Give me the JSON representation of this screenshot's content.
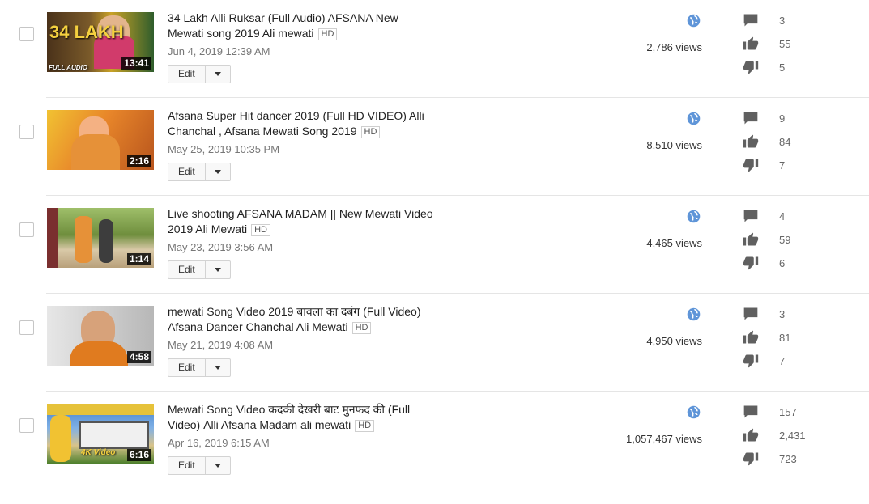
{
  "videos": [
    {
      "title": "34 Lakh Alli Ruksar (Full Audio) AFSANA New Mewati song 2019 Ali mewati",
      "hd": "HD",
      "date": "Jun 4, 2019 12:39 AM",
      "duration": "13:41",
      "thumb_overlay": "34 LAKH",
      "thumb_caption": "FULL AUDIO",
      "views": "2,786 views",
      "comments": "3",
      "likes": "55",
      "dislikes": "5",
      "edit_label": "Edit",
      "thumb_colors": [
        "#5a3b1e",
        "#c9a227",
        "#2f5d2c"
      ]
    },
    {
      "title": "Afsana Super Hit dancer 2019 (Full HD VIDEO) Alli Chanchal , Afsana Mewati Song 2019",
      "hd": "HD",
      "date": "May 25, 2019 10:35 PM",
      "duration": "2:16",
      "views": "8,510 views",
      "comments": "9",
      "likes": "84",
      "dislikes": "7",
      "edit_label": "Edit",
      "thumb_colors": [
        "#e8862a",
        "#f1c232",
        "#b8551d"
      ]
    },
    {
      "title": "Live shooting AFSANA MADAM || New Mewati Video 2019 Ali Mewati",
      "hd": "HD",
      "date": "May 23, 2019 3:56 AM",
      "duration": "1:14",
      "views": "4,465 views",
      "comments": "4",
      "likes": "59",
      "dislikes": "6",
      "edit_label": "Edit",
      "thumb_colors": [
        "#6f8e3d",
        "#d9b48a",
        "#7a2f2f"
      ]
    },
    {
      "title": "mewati Song Video 2019 बावला का दबंग (Full Video) Afsana Dancer Chanchal Ali Mewati",
      "hd": "HD",
      "date": "May 21, 2019 4:08 AM",
      "duration": "4:58",
      "views": "4,950 views",
      "comments": "3",
      "likes": "81",
      "dislikes": "7",
      "edit_label": "Edit",
      "thumb_colors": [
        "#cfcfcf",
        "#e07b1f",
        "#8b5a3c"
      ]
    },
    {
      "title": "Mewati Song Video कदकी देखरी बाट मुनफद की (Full Video) Alli Afsana Madam ali mewati",
      "hd": "HD",
      "date": "Apr 16, 2019 6:15 AM",
      "duration": "6:16",
      "thumb_overlay": "4K Video",
      "views": "1,057,467 views",
      "comments": "157",
      "likes": "2,431",
      "dislikes": "723",
      "edit_label": "Edit",
      "thumb_colors": [
        "#3f7ec9",
        "#e6c23a",
        "#4d7f2c"
      ]
    }
  ],
  "icons": {
    "visibility": "globe-icon",
    "comments": "comment-icon",
    "likes": "thumbs-up-icon",
    "dislikes": "thumbs-down-icon",
    "edit_menu": "chevron-down-icon"
  },
  "colors": {
    "globe": "#5f95d8",
    "stat_icon": "#606060",
    "divider": "#e5e5e5"
  }
}
